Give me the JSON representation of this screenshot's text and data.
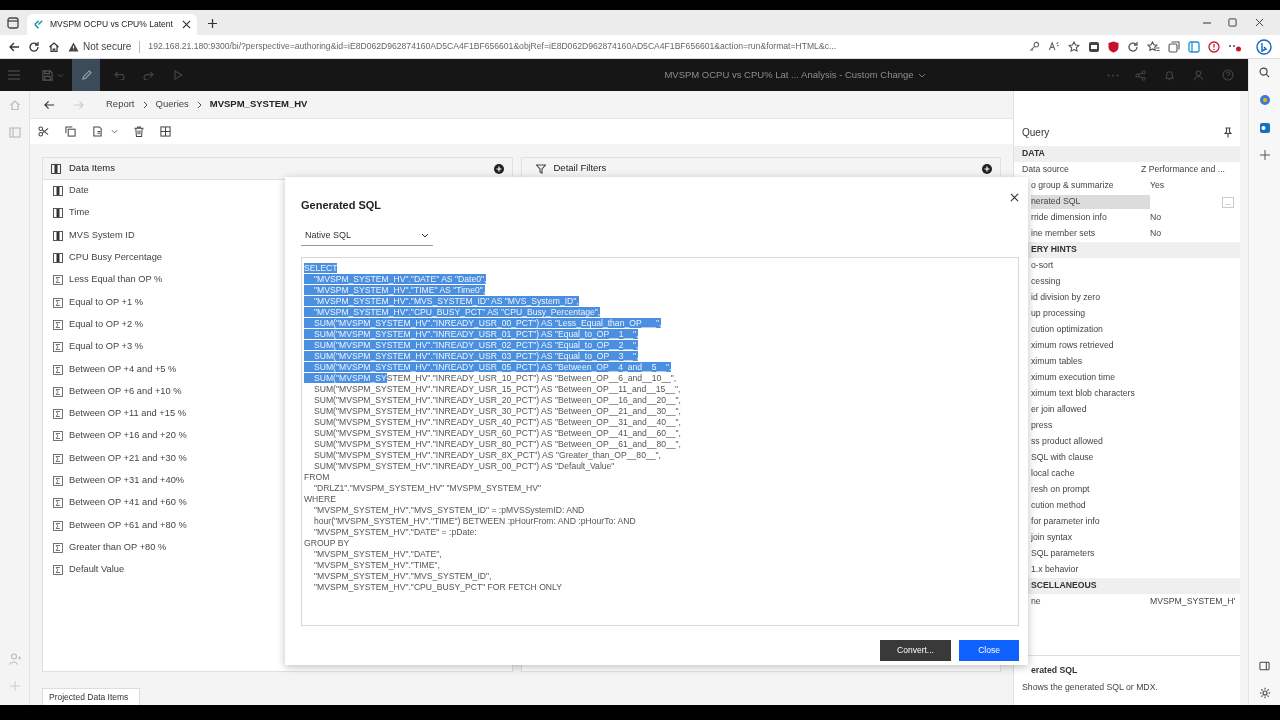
{
  "browser": {
    "tab_title": "MVSPM OCPU vs CPU% Latent",
    "security": "Not secure",
    "url": "192.168.21.180:9300/bi/?perspective=authoring&id=iE8D062D962874160AD5CA4F1BF656601&objRef=iE8D062D962874160AD5CA4F1BF656601&action=run&format=HTML&c..."
  },
  "app": {
    "title": "MVSPM OCPU vs CPU% Lat ... Analysis - Custom Change"
  },
  "breadcrumb": [
    {
      "label": "Report",
      "current": false
    },
    {
      "label": "Queries",
      "current": false
    },
    {
      "label": "MVSPM_SYSTEM_HV",
      "current": true
    }
  ],
  "data_items": {
    "title": "Data Items",
    "items": [
      {
        "label": "Date",
        "kind": "column"
      },
      {
        "label": "Time",
        "kind": "column"
      },
      {
        "label": "MVS System ID",
        "kind": "column"
      },
      {
        "label": "CPU Busy Percentage",
        "kind": "column"
      },
      {
        "label": "Less Equal than OP %",
        "kind": "measure"
      },
      {
        "label": "Equal to OP +1 %",
        "kind": "measure"
      },
      {
        "label": "Equal to OP +2 %",
        "kind": "measure"
      },
      {
        "label": "Equal to OP +3 %",
        "kind": "measure"
      },
      {
        "label": "Between OP +4 and +5 %",
        "kind": "measure"
      },
      {
        "label": "Between OP +6 and +10 %",
        "kind": "measure"
      },
      {
        "label": "Between OP +11 and +15 %",
        "kind": "measure"
      },
      {
        "label": "Between OP +16 and +20 %",
        "kind": "measure"
      },
      {
        "label": "Between OP +21 and +30 %",
        "kind": "measure"
      },
      {
        "label": "Between OP +31 and +40%",
        "kind": "measure"
      },
      {
        "label": "Between OP +41 and +60 %",
        "kind": "measure"
      },
      {
        "label": "Between OP +61 and +80 %",
        "kind": "measure"
      },
      {
        "label": "Greater than OP +80 %",
        "kind": "measure"
      },
      {
        "label": "Default Value",
        "kind": "measure"
      }
    ]
  },
  "detail_filters": {
    "title": "Detail Filters"
  },
  "bottom_tabs": [
    {
      "label": "Projected Data Items",
      "selected": true
    }
  ],
  "query_panel": {
    "title": "Query",
    "rows": [
      {
        "kind": "section",
        "label": "DATA"
      },
      {
        "kind": "property",
        "label": "Data source",
        "value": "Z Performance and ...",
        "selected": false
      },
      {
        "kind": "property",
        "label": "o group & summarize",
        "value": "Yes",
        "selected": false
      },
      {
        "kind": "property",
        "label": "nerated SQL",
        "action_label": "...",
        "selected": true
      },
      {
        "kind": "property",
        "label": "rride dimension info",
        "value": "No",
        "selected": false
      },
      {
        "kind": "property",
        "label": "ine member sets",
        "value": "No",
        "selected": false
      },
      {
        "kind": "section",
        "label": "ERY HINTS"
      },
      {
        "kind": "property",
        "label": "o-sort",
        "selected": false
      },
      {
        "kind": "property",
        "label": "cessing",
        "selected": false
      },
      {
        "kind": "property",
        "label": "id division by zero",
        "selected": false
      },
      {
        "kind": "property",
        "label": "up processing",
        "selected": false
      },
      {
        "kind": "property",
        "label": "cution optimization",
        "selected": false
      },
      {
        "kind": "property",
        "label": "ximum rows retrieved",
        "selected": false
      },
      {
        "kind": "property",
        "label": "ximum tables",
        "selected": false
      },
      {
        "kind": "property",
        "label": "ximum execution time",
        "selected": false
      },
      {
        "kind": "property",
        "label": "ximum text blob characters",
        "selected": false
      },
      {
        "kind": "property",
        "label": "er join allowed",
        "selected": false
      },
      {
        "kind": "property",
        "label": "press",
        "selected": false
      },
      {
        "kind": "property",
        "label": "ss product allowed",
        "selected": false
      },
      {
        "kind": "property",
        "label": "SQL with clause",
        "selected": false
      },
      {
        "kind": "property",
        "label": "local cache",
        "selected": false
      },
      {
        "kind": "property",
        "label": "resh on prompt",
        "selected": false
      },
      {
        "kind": "property",
        "label": "cution method",
        "selected": false
      },
      {
        "kind": "property",
        "label": "for parameter info",
        "selected": false
      },
      {
        "kind": "property",
        "label": "join syntax",
        "selected": false
      },
      {
        "kind": "property",
        "label": "SQL parameters",
        "selected": false
      },
      {
        "kind": "property",
        "label": "1.x behavior",
        "selected": false
      },
      {
        "kind": "section",
        "label": "SCELLANEOUS"
      },
      {
        "kind": "property",
        "label": "ne",
        "value": "MVSPM_SYSTEM_H'",
        "selected": false
      }
    ],
    "help": {
      "title": "erated SQL",
      "text": "Shows the generated SQL or MDX."
    }
  },
  "dialog": {
    "title": "Generated SQL",
    "sql_type": "Native SQL",
    "lines": [
      {
        "kind": "keyword",
        "selection": "SELECT"
      },
      {
        "kind": "clause",
        "selection": "\"MVSPM_SYSTEM_HV\".\"DATE\" AS \"Date0\","
      },
      {
        "kind": "clause",
        "selection": "\"MVSPM_SYSTEM_HV\".\"TIME\" AS \"Time0\","
      },
      {
        "kind": "clause",
        "selection": "\"MVSPM_SYSTEM_HV\".\"MVS_SYSTEM_ID\" AS \"MVS_System_ID\","
      },
      {
        "kind": "clause",
        "selection": "\"MVSPM_SYSTEM_HV\".\"CPU_BUSY_PCT\" AS \"CPU_Busy_Percentage\","
      },
      {
        "kind": "clause",
        "selection": "SUM(\"MVSPM_SYSTEM_HV\".\"INREADY_USR_00_PCT\") AS \"Less_Equal_than_OP___\","
      },
      {
        "kind": "clause",
        "selection": "SUM(\"MVSPM_SYSTEM_HV\".\"INREADY_USR_01_PCT\") AS \"Equal_to_OP__1__\","
      },
      {
        "kind": "clause",
        "selection": "SUM(\"MVSPM_SYSTEM_HV\".\"INREADY_USR_02_PCT\") AS \"Equal_to_OP__2__\","
      },
      {
        "kind": "clause",
        "selection": "SUM(\"MVSPM_SYSTEM_HV\".\"INREADY_USR_03_PCT\") AS \"Equal_to_OP__3__\","
      },
      {
        "kind": "clause",
        "selection": "SUM(\"MVSPM_SYSTEM_HV\".\"INREADY_USR_05_PCT\") AS \"Between_OP__4_and__5__\","
      },
      {
        "kind": "clause",
        "selection": "SUM(\"MVSPM_SY",
        "text": "STEM_HV\".\"INREADY_USR_10_PCT\") AS \"Between_OP__6_and__10__\","
      },
      {
        "kind": "clause",
        "text": "SUM(\"MVSPM_SYSTEM_HV\".\"INREADY_USR_15_PCT\") AS \"Between_OP__11_and__15__\","
      },
      {
        "kind": "clause",
        "text": "SUM(\"MVSPM_SYSTEM_HV\".\"INREADY_USR_20_PCT\") AS \"Between_OP__16_and__20__\","
      },
      {
        "kind": "clause",
        "text": "SUM(\"MVSPM_SYSTEM_HV\".\"INREADY_USR_30_PCT\") AS \"Between_OP__21_and__30__\","
      },
      {
        "kind": "clause",
        "text": "SUM(\"MVSPM_SYSTEM_HV\".\"INREADY_USR_40_PCT\") AS \"Between_OP__31_and__40__\","
      },
      {
        "kind": "clause",
        "text": "SUM(\"MVSPM_SYSTEM_HV\".\"INREADY_USR_60_PCT\") AS \"Between_OP__41_and__60__\","
      },
      {
        "kind": "clause",
        "text": "SUM(\"MVSPM_SYSTEM_HV\".\"INREADY_USR_80_PCT\") AS \"Between_OP__61_and__80__\","
      },
      {
        "kind": "clause",
        "text": "SUM(\"MVSPM_SYSTEM_HV\".\"INREADY_USR_8X_PCT\") AS \"Greater_than_OP__80__\","
      },
      {
        "kind": "clause",
        "text": "SUM(\"MVSPM_SYSTEM_HV\".\"INREADY_USR_00_PCT\") AS \"Default_Value\""
      },
      {
        "kind": "keyword",
        "text": "FROM"
      },
      {
        "kind": "clause",
        "text": "\"DRLZ1\".\"MVSPM_SYSTEM_HV\" \"MVSPM_SYSTEM_HV\""
      },
      {
        "kind": "keyword",
        "text": "WHERE"
      },
      {
        "kind": "clause",
        "text": "\"MVSPM_SYSTEM_HV\".\"MVS_SYSTEM_ID\" = :pMVSSystemID: AND"
      },
      {
        "kind": "clause",
        "text": "hour(\"MVSPM_SYSTEM_HV\".\"TIME\") BETWEEN :pHourFrom: AND :pHourTo: AND"
      },
      {
        "kind": "clause",
        "text": "\"MVSPM_SYSTEM_HV\".\"DATE\" = :pDate:"
      },
      {
        "kind": "keyword",
        "text": "GROUP BY"
      },
      {
        "kind": "clause",
        "text": "\"MVSPM_SYSTEM_HV\".\"DATE\","
      },
      {
        "kind": "clause",
        "text": "\"MVSPM_SYSTEM_HV\".\"TIME\","
      },
      {
        "kind": "clause",
        "text": "\"MVSPM_SYSTEM_HV\".\"MVS_SYSTEM_ID\","
      },
      {
        "kind": "clause",
        "text": "\"MVSPM_SYSTEM_HV\".\"CPU_BUSY_PCT\" FOR FETCH ONLY"
      }
    ],
    "buttons": [
      {
        "label": "Convert...",
        "kind": "secondary"
      },
      {
        "label": "Close",
        "kind": "primary"
      }
    ]
  }
}
